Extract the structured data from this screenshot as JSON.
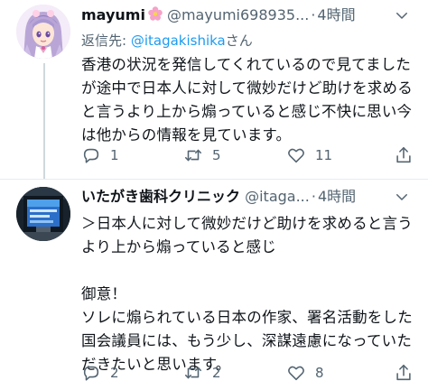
{
  "tweets": [
    {
      "name": "mayumi",
      "handle": "@mayumi698935...",
      "separator": "·",
      "time": "4時間",
      "reply_prefix": "返信先: ",
      "reply_mention": "@itagakishika",
      "reply_suffix": "さん",
      "text": "香港の状況を発信してくれているので見てましたが途中で日本人に対して微妙だけど助けを求めると言うより上から煽っていると感じ不快に思い今は他からの情報を見ています。",
      "replies": "1",
      "retweets": "5",
      "likes": "11",
      "icons": {
        "name_badge": "pink-flower-icon",
        "menu": "chevron-down-icon",
        "reply": "reply-bubble-icon",
        "retweet": "retweet-icon",
        "like": "heart-icon",
        "share": "share-icon"
      }
    },
    {
      "name": "いたがき歯科クリニック",
      "handle": "@itaga...",
      "separator": "·",
      "time": "4時間",
      "text": "＞日本人に対して微妙だけど助けを求めると言うより上から煽っていると感じ\n\n御意！\nソレに煽られている日本の作家、署名活動をした国会議員には、もう少し、深謀遠慮になっていただきたいと思います。",
      "replies": "2",
      "retweets": "2",
      "likes": "8"
    }
  ],
  "colors": {
    "text": "#0f1419",
    "secondary": "#536471",
    "link": "#1d9bf0",
    "divider": "#e6ecf0"
  }
}
